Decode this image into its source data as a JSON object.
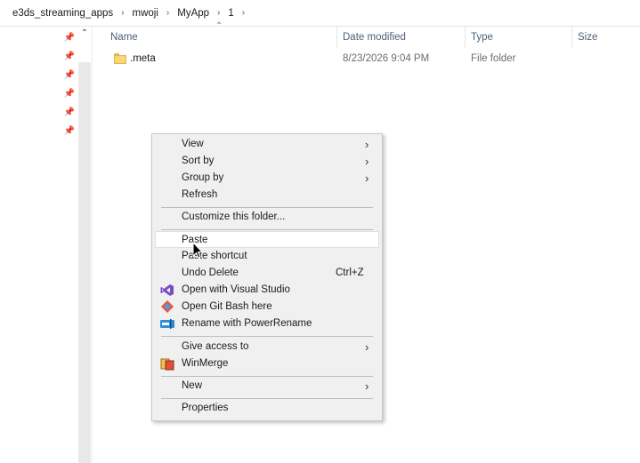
{
  "breadcrumb": [
    "e3ds_streaming_apps",
    "mwoji",
    "MyApp",
    "1"
  ],
  "columns": {
    "name": "Name",
    "date_modified": "Date modified",
    "type": "Type",
    "size": "Size"
  },
  "files": [
    {
      "name": ".meta",
      "date_modified": "8/23/2026 9:04 PM",
      "type": "File folder",
      "size": ""
    }
  ],
  "context_menu": {
    "view": "View",
    "sort_by": "Sort by",
    "group_by": "Group by",
    "refresh": "Refresh",
    "customize": "Customize this folder...",
    "paste": "Paste",
    "paste_shortcut": "Paste shortcut",
    "undo_delete": "Undo Delete",
    "undo_delete_shortcut": "Ctrl+Z",
    "open_vs": "Open with Visual Studio",
    "open_git_bash": "Open Git Bash here",
    "power_rename": "Rename with PowerRename",
    "give_access": "Give access to",
    "winmerge": "WinMerge",
    "new": "New",
    "properties": "Properties"
  },
  "colors": {
    "menu_bg": "#f0f0f0",
    "header_text": "#4c607a",
    "folder": "#f8d775"
  }
}
